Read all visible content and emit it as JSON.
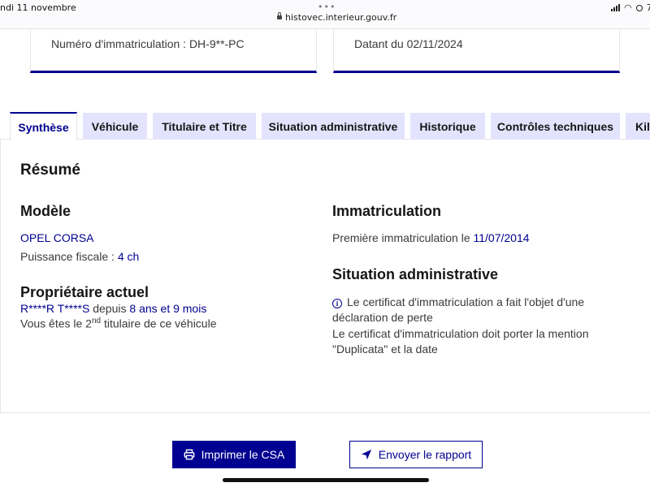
{
  "status_bar": {
    "date": "ndi 11 novembre",
    "url": "histovec.interieur.gouv.fr",
    "more_dots": "•••",
    "battery": "7"
  },
  "cards": {
    "plate": "Numéro d'immatriculation : DH-9**-PC",
    "date": "Datant du 02/11/2024"
  },
  "tabs": [
    {
      "label": "Synthèse"
    },
    {
      "label": "Véhicule"
    },
    {
      "label": "Titulaire et Titre"
    },
    {
      "label": "Situation administrative"
    },
    {
      "label": "Historique"
    },
    {
      "label": "Contrôles techniques"
    },
    {
      "label": "Kilo"
    }
  ],
  "summary": {
    "title": "Résumé",
    "model": {
      "heading": "Modèle",
      "name": "OPEL CORSA",
      "power_label": "Puissance fiscale :",
      "power_value": "4 ch"
    },
    "owner": {
      "heading": "Propriétaire actuel",
      "name": "R****R T****S",
      "since_label": "depuis",
      "since_value": "8 ans et 9 mois",
      "rank_prefix": "Vous êtes le 2",
      "rank_sup": "nd",
      "rank_suffix": " titulaire de ce véhicule"
    },
    "registration": {
      "heading": "Immatriculation",
      "first_label": "Première immatriculation le",
      "first_date": "11/07/2014"
    },
    "admin": {
      "heading": "Situation administrative",
      "line1": "Le certificat d'immatriculation a fait l'objet d'une",
      "line2": "déclaration de perte",
      "line3": "Le certificat d'immatriculation doit porter la mention",
      "line4": "\"Duplicata\" et la date"
    }
  },
  "buttons": {
    "print": "Imprimer le CSA",
    "send": "Envoyer le rapport"
  },
  "colors": {
    "primary": "#000091",
    "tab_bg": "#e3e3fd"
  }
}
